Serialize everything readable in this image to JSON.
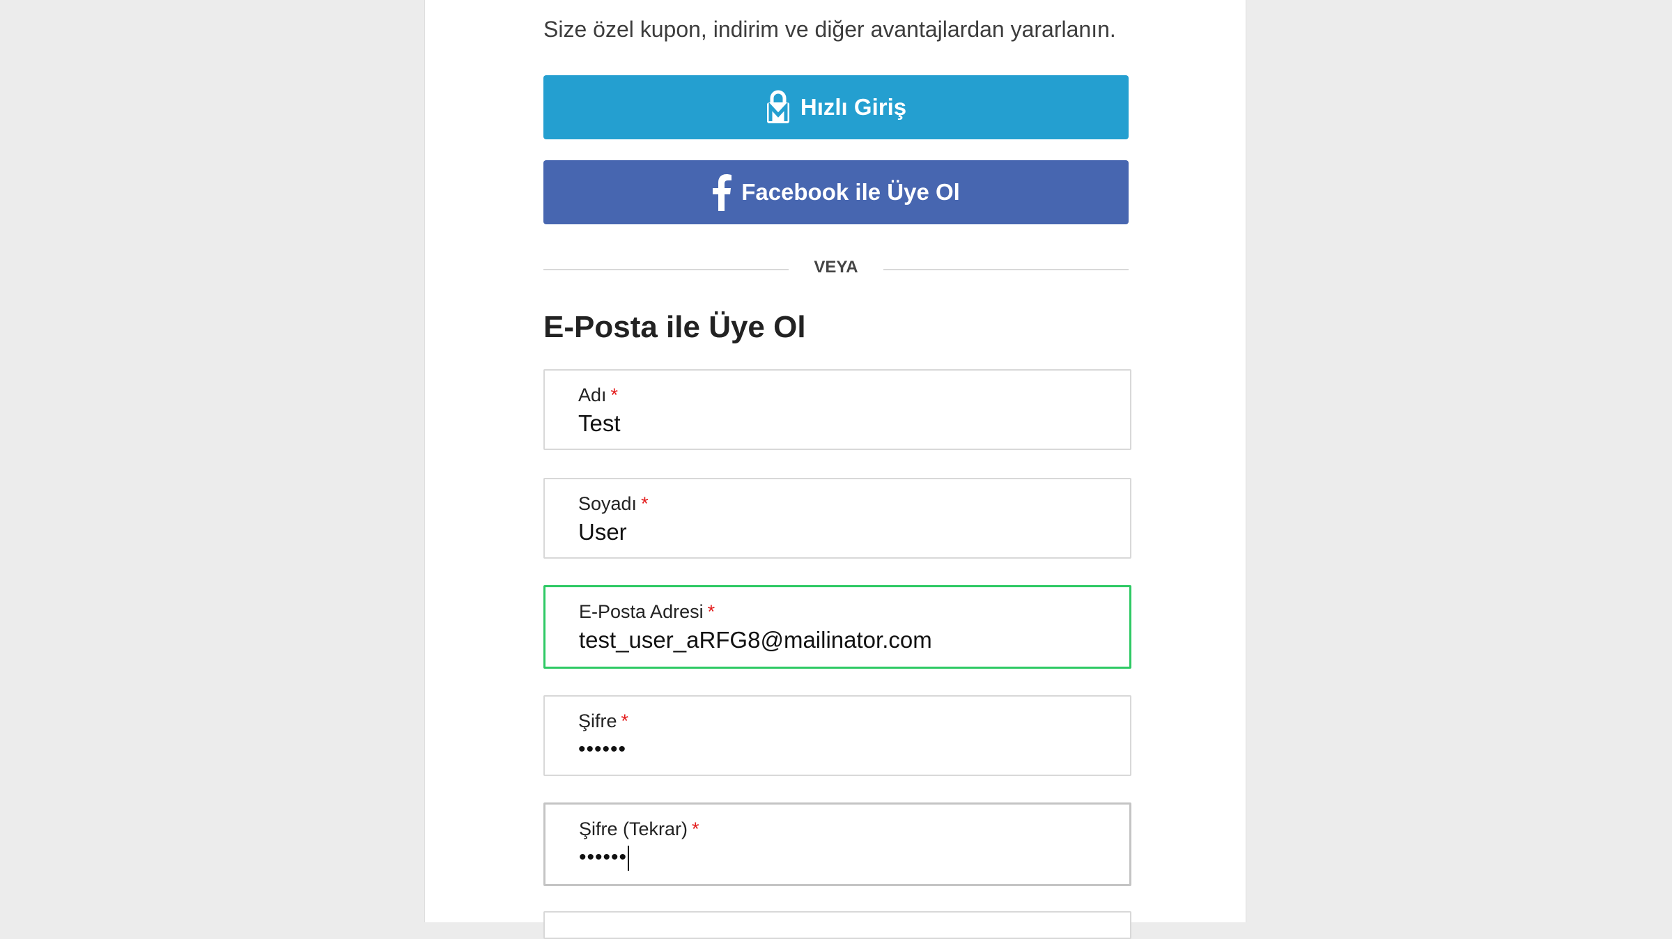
{
  "intro": {
    "subtitle": "Size özel kupon, indirim ve diğer avantajlardan yararlanın."
  },
  "buttons": {
    "quick_login_label": "Hızlı Giriş",
    "quick_login_icon": "m-lock-icon",
    "facebook_label": "Facebook ile Üye Ol",
    "facebook_icon": "facebook-icon"
  },
  "divider": {
    "text": "VEYA"
  },
  "form": {
    "title": "E-Posta ile Üye Ol",
    "required_mark": "*",
    "fields": [
      {
        "label": "Adı",
        "value": "Test"
      },
      {
        "label": "Soyadı",
        "value": "User"
      },
      {
        "label": "E-Posta Adresi",
        "value": "test_user_aRFG8@mailinator.com"
      },
      {
        "label": "Şifre",
        "value": "••••••"
      },
      {
        "label": "Şifre (Tekrar)",
        "value": "••••••"
      }
    ]
  },
  "colors": {
    "background": "#ececec",
    "quick_login": "#249fd0",
    "facebook": "#4766b0",
    "focus_border": "#2ec964",
    "required": "#e31b1b"
  }
}
